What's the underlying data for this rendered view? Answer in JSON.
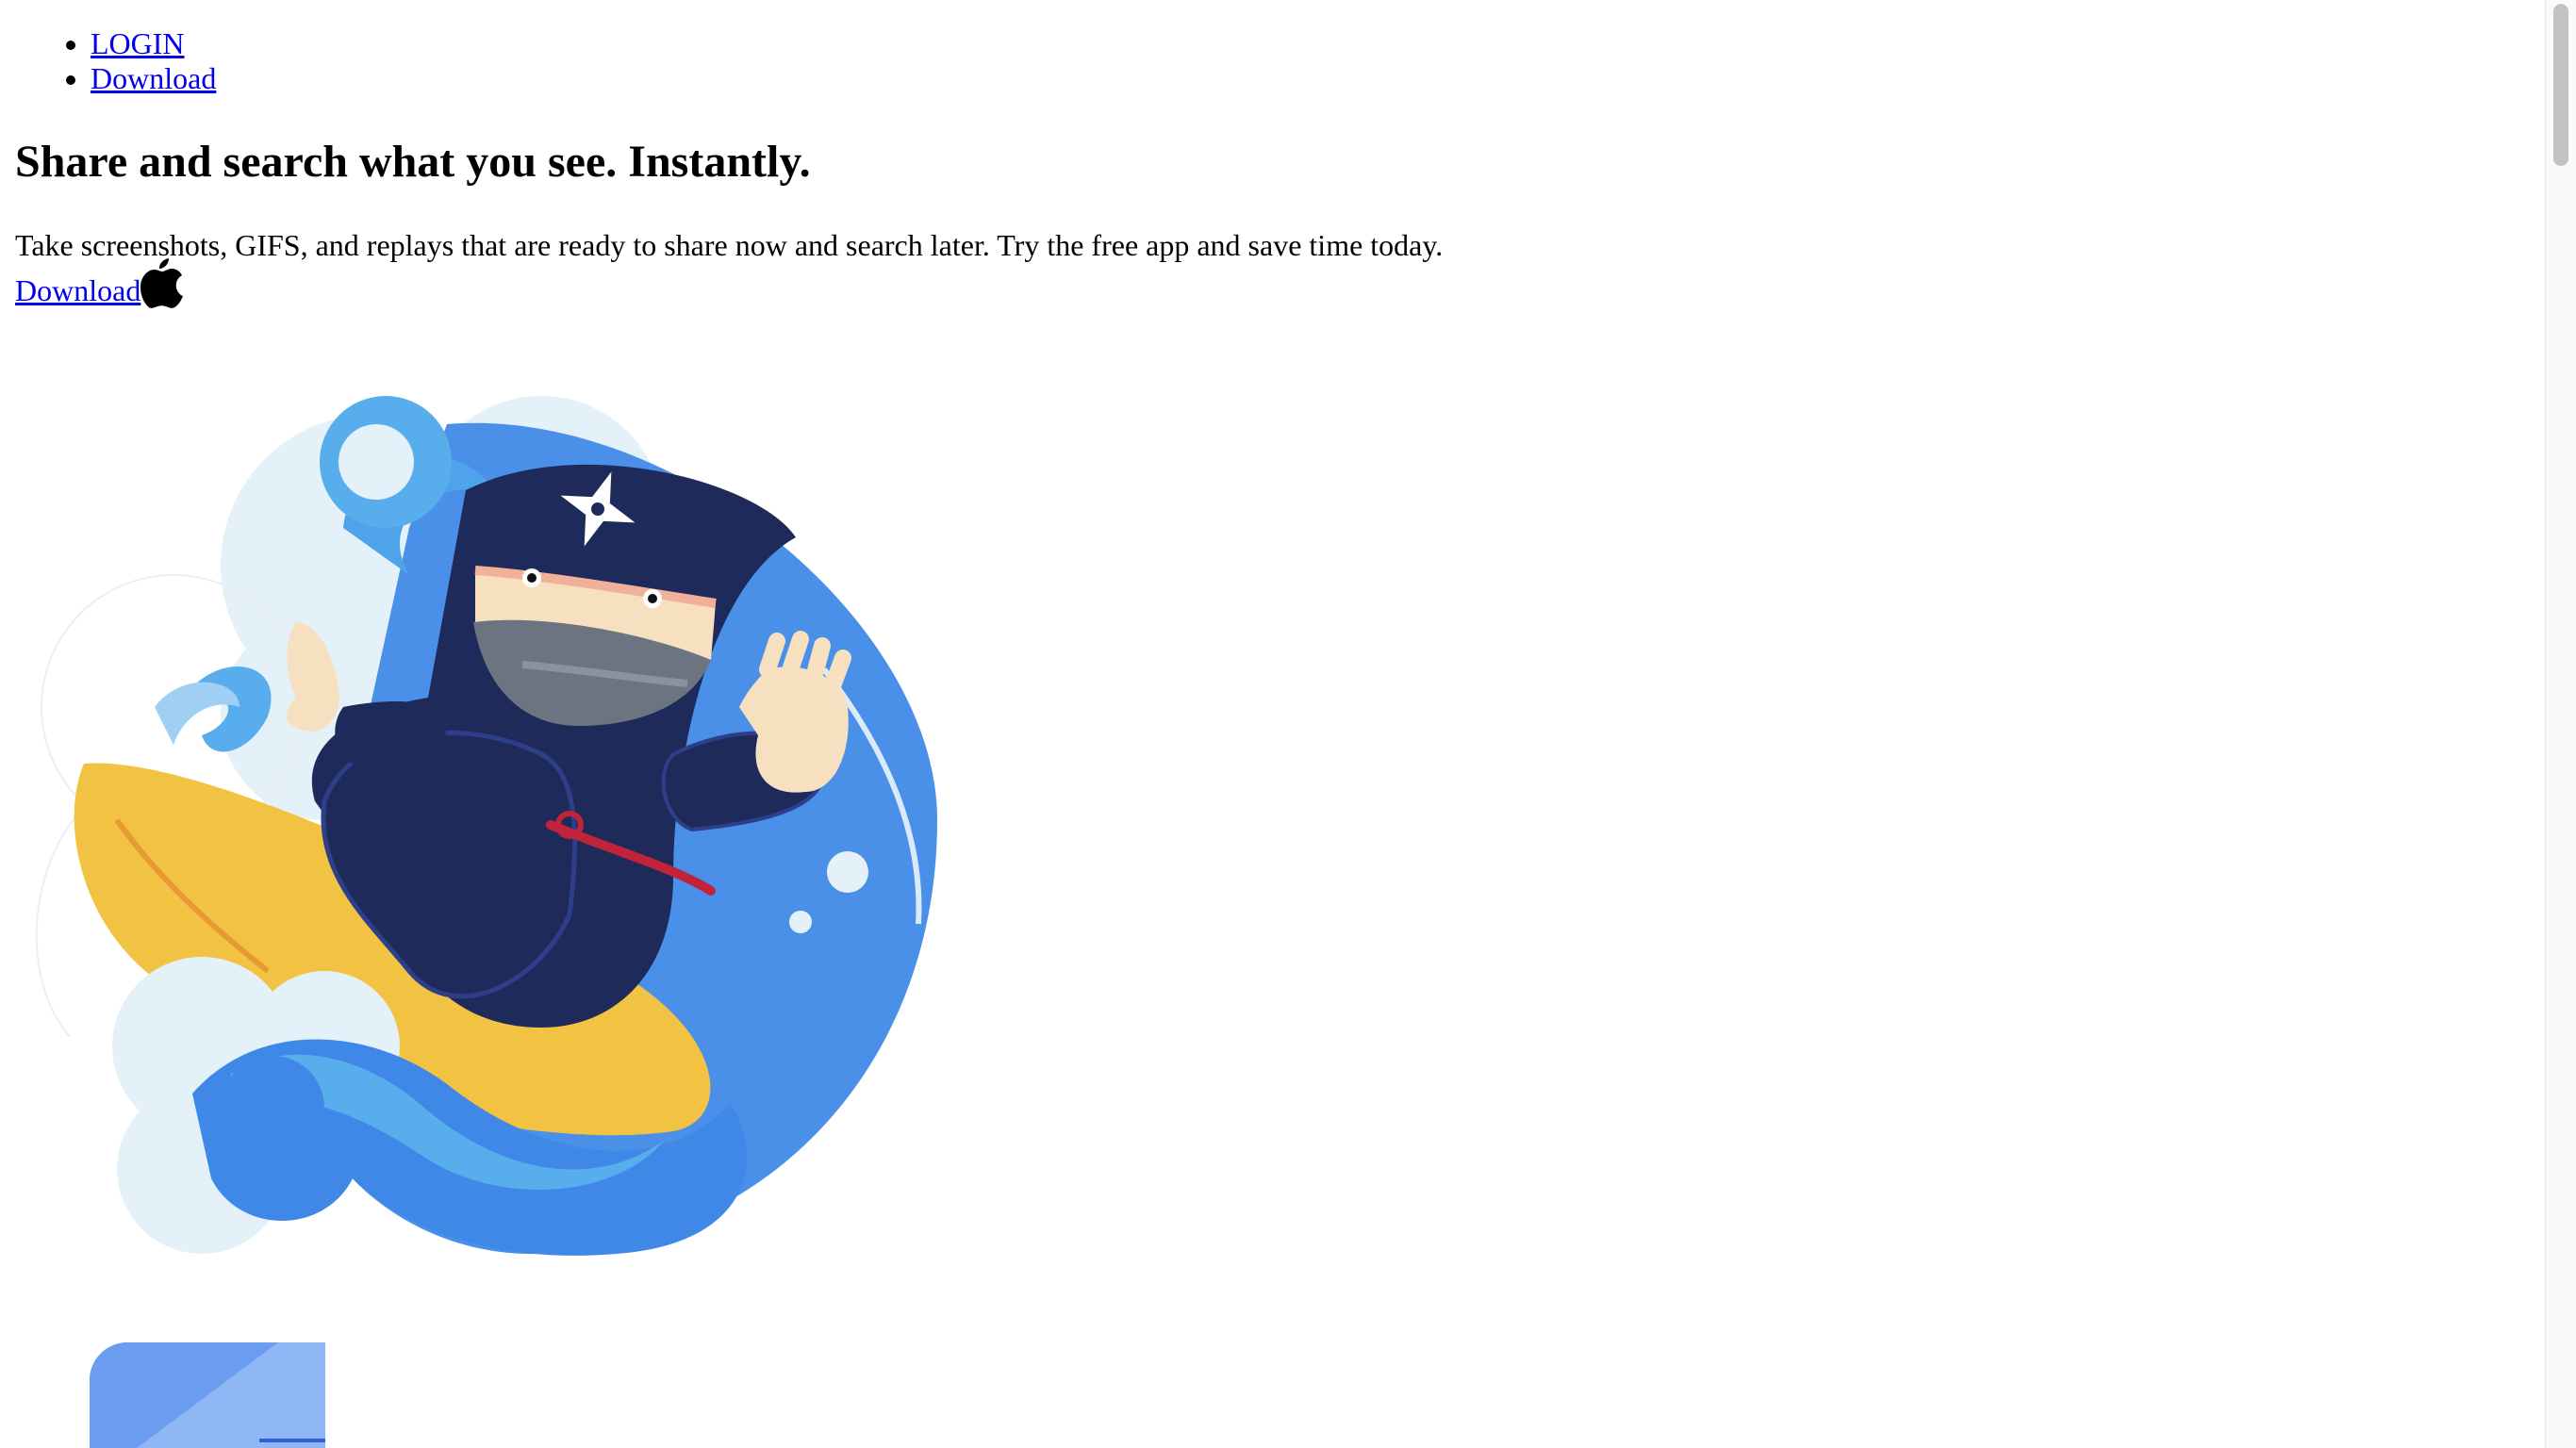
{
  "nav": {
    "items": [
      {
        "label": "LOGIN"
      },
      {
        "label": "Download"
      }
    ]
  },
  "hero": {
    "title": "Share and search what you see. Instantly.",
    "subtitle": "Take screenshots, GIFS, and replays that are ready to share now and search later. Try the free app and save time today.",
    "download_label": "Download",
    "download_icon": "apple-icon",
    "illustration": "ninja-surfing-wave-illustration"
  },
  "colors": {
    "link": "#0000ee",
    "ninja_navy": "#1e2a5a",
    "wave_blue": "#3f88e8",
    "wave_light": "#e4f1f9",
    "surfboard_yellow": "#f2c343",
    "skin": "#f6e0c0",
    "belt_red": "#c0233a"
  }
}
